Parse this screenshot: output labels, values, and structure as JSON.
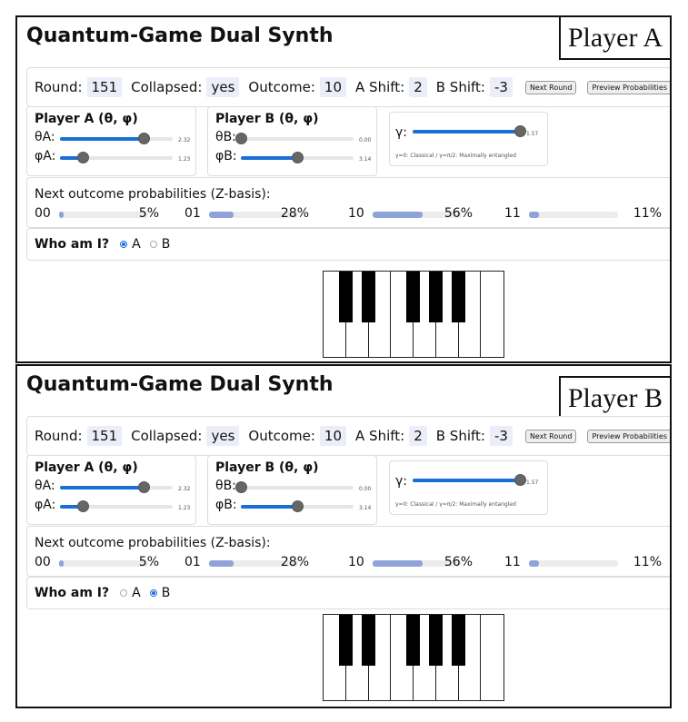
{
  "app_title": "Quantum-Game Dual Synth",
  "panels": [
    {
      "player_tag": "Player A",
      "who_selected": "A"
    },
    {
      "player_tag": "Player B",
      "who_selected": "B"
    }
  ],
  "status": {
    "round_label": "Round:",
    "round_value": "151",
    "collapsed_label": "Collapsed:",
    "collapsed_value": "yes",
    "outcome_label": "Outcome:",
    "outcome_value": "10",
    "a_shift_label": "A Shift:",
    "a_shift_value": "2",
    "b_shift_label": "B Shift:",
    "b_shift_value": "-3",
    "next_round_button": "Next Round",
    "preview_button": "Preview Probabilities"
  },
  "player_a": {
    "title": "Player A (θ, φ)",
    "theta_label": "θA:",
    "theta_value": "2.32",
    "theta_fraction": 0.74,
    "phi_label": "φA:",
    "phi_value": "1.23",
    "phi_fraction": 0.2
  },
  "player_b": {
    "title": "Player B (θ, φ)",
    "theta_label": "θB:",
    "theta_value": "0.00",
    "theta_fraction": 0.0,
    "phi_label": "φB:",
    "phi_value": "3.14",
    "phi_fraction": 0.5
  },
  "gamma": {
    "label": "γ:",
    "value": "1.57",
    "fraction": 1.0,
    "note": "γ=0: Classical / γ=π/2: Maximally entangled"
  },
  "probabilities": {
    "title": "Next outcome probabilities (Z-basis):",
    "items": [
      {
        "name": "00",
        "pct": "5%",
        "value": 0.05
      },
      {
        "name": "01",
        "pct": "28%",
        "value": 0.28
      },
      {
        "name": "10",
        "pct": "56%",
        "value": 0.56
      },
      {
        "name": "11",
        "pct": "11%",
        "value": 0.11
      }
    ]
  },
  "who": {
    "label": "Who am I?",
    "option_a": "A",
    "option_b": "B"
  },
  "colors": {
    "accent": "#1a6fd6",
    "prob_fill": "#8ea3d8",
    "value_bg": "#ebeef8"
  }
}
